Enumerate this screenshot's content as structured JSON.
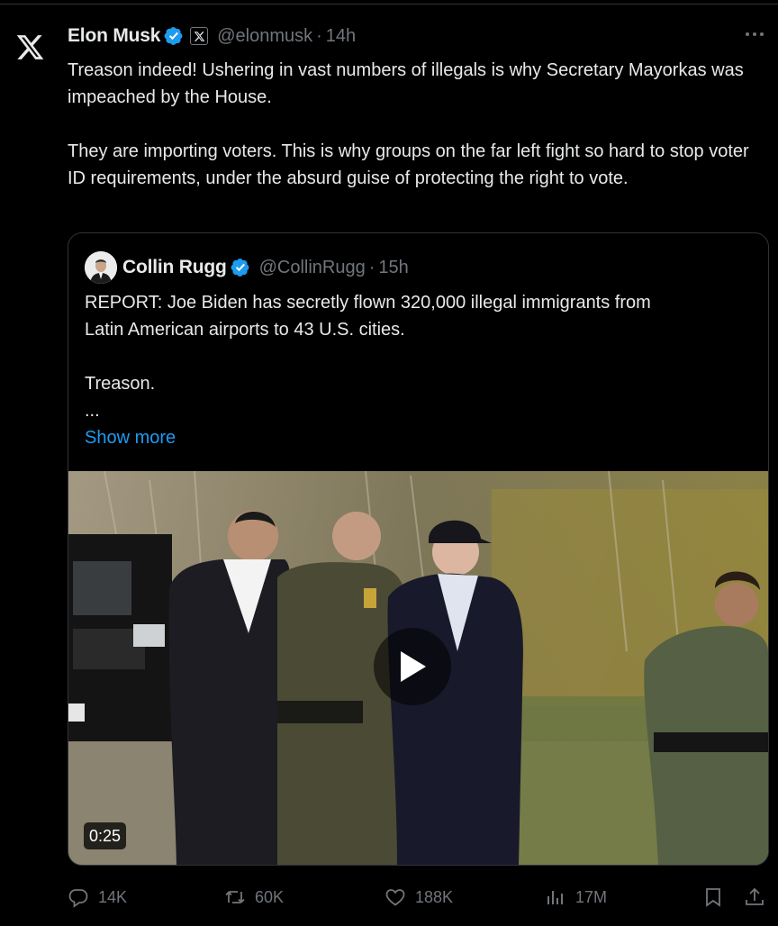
{
  "tweet": {
    "author_name": "Elon Musk",
    "affiliate_badge": "X",
    "handle": "@elonmusk",
    "separator": "·",
    "time": "14h",
    "paragraphs": [
      "Treason indeed! Ushering in vast numbers of illegals is why Secretary Mayorkas was impeached by the House.",
      "They are importing voters. This is why groups on the far left fight so hard to stop voter ID requirements, under the absurd guise of protecting the right to vote."
    ]
  },
  "quote": {
    "author_name": "Collin Rugg",
    "handle": "@CollinRugg",
    "separator": "·",
    "time": "15h",
    "line1": "REPORT: Joe Biden has secretly flown 320,000 illegal immigrants from",
    "line2": "Latin American airports to 43 U.S. cities.",
    "line3": "Treason.",
    "ellipsis": "...",
    "show_more": "Show more",
    "video_duration": "0:25"
  },
  "actions": {
    "replies": "14K",
    "reposts": "60K",
    "likes": "188K",
    "views": "17M"
  },
  "colors": {
    "background": "#000000",
    "text": "#e7e9ea",
    "secondary": "#71767b",
    "accent": "#1d9bf0",
    "border": "#2f3336"
  },
  "icons": [
    "x-logo-icon",
    "verified-badge-icon",
    "more-icon",
    "play-icon",
    "reply-icon",
    "repost-icon",
    "like-icon",
    "views-icon",
    "bookmark-icon",
    "share-icon"
  ]
}
